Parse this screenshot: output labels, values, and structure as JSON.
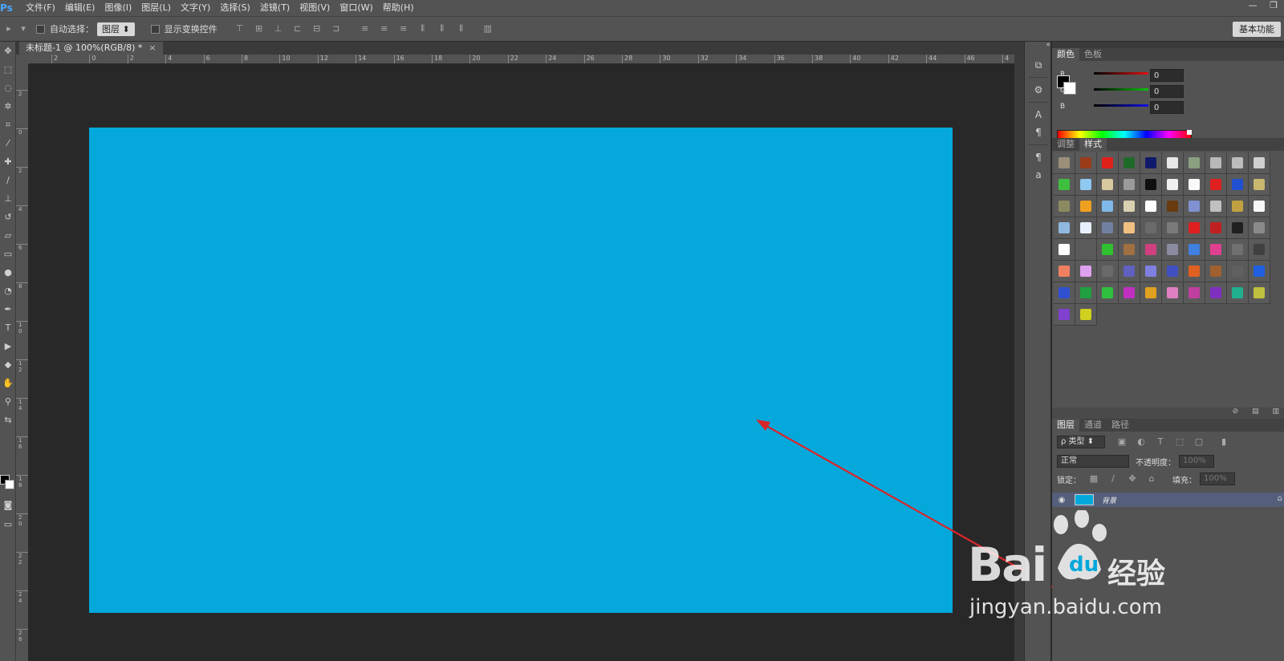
{
  "app": {
    "logo": "Ps",
    "menu": [
      "文件(F)",
      "编辑(E)",
      "图像(I)",
      "图层(L)",
      "文字(Y)",
      "选择(S)",
      "滤镜(T)",
      "视图(V)",
      "窗口(W)",
      "帮助(H)"
    ],
    "window_buttons": [
      "—",
      "❐"
    ]
  },
  "options_bar": {
    "auto_select_label": "自动选择：",
    "auto_select_value": "图层",
    "show_transform_label": "显示变换控件",
    "workspace": "基本功能"
  },
  "document": {
    "tab_title": "未标题-1 @ 100%(RGB/8) *",
    "close_glyph": "×",
    "canvas_color": "#04a8db"
  },
  "rulers": {
    "h_labels": [
      "2",
      "0",
      "2",
      "4",
      "6",
      "8",
      "10",
      "12",
      "14",
      "16",
      "18",
      "20",
      "22",
      "24",
      "26",
      "28",
      "30",
      "32",
      "34",
      "36",
      "38",
      "40",
      "42",
      "44",
      "46",
      "4"
    ],
    "v_labels": [
      "2",
      "0",
      "2",
      "4",
      "6",
      "8",
      "1\n0",
      "1\n2",
      "1\n4",
      "1\n6",
      "1\n8",
      "2\n0",
      "2\n2",
      "2\n4",
      "2\n6"
    ]
  },
  "color_panel": {
    "tabs": [
      "颜色",
      "色板"
    ],
    "channels": [
      {
        "label": "R",
        "value": "0",
        "color": "#e01010"
      },
      {
        "label": "G",
        "value": "0",
        "color": "#10c010"
      },
      {
        "label": "B",
        "value": "0",
        "color": "#1010e0"
      }
    ]
  },
  "styles_panel": {
    "tabs": [
      "调整",
      "样式"
    ],
    "swatches": [
      "#9a8f78",
      "#9a3b1a",
      "#e0201a",
      "#1f6a2a",
      "#101a6a",
      "#e8e8e8",
      "#8aa080",
      "#b8b8b8",
      "#bcbcbc",
      "#d0d0d0",
      "#3fbf3f",
      "#8fc8f0",
      "#d8c8a0",
      "#9a9a9a",
      "#101010",
      "#f0f0f0",
      "#fafafa",
      "#e02020",
      "#2050d0",
      "#c8b870",
      "#8a8a60",
      "#f0a020",
      "#80b8e8",
      "#d8d0b0",
      "#ffffff",
      "#6a3a10",
      "#8090d0",
      "#c0c0c0",
      "#c0a040",
      "#f8f8f8",
      "#90b8e0",
      "#e8f0ff",
      "#7080a0",
      "#f0c080",
      "#6a6a6a",
      "#7a7a7a",
      "#e02020",
      "#c02020",
      "#202020",
      "#8a8a8a",
      "#ffffff",
      "#5a5a5a",
      "#30c030",
      "#a07040",
      "#d04080",
      "#8a8aa0",
      "#4080e0",
      "#e04090",
      "#707070",
      "#404040",
      "#f08060",
      "#e0a0f0",
      "#6a6a6a",
      "#6060c0",
      "#8080e0",
      "#4050c0",
      "#e06020",
      "#a06030",
      "#606060",
      "#2060e0",
      "#3050d0",
      "#20a040",
      "#30c040",
      "#c030c0",
      "#e0a020",
      "#e080c0",
      "#c040a0",
      "#8030c0",
      "#20b090",
      "#c0c040",
      "#8040d0",
      "#d0d020"
    ]
  },
  "layers_panel": {
    "tabs": [
      "图层",
      "通道",
      "路径"
    ],
    "filter_label": "ρ 类型",
    "blend_mode": "正常",
    "opacity_label": "不透明度：",
    "opacity_value": "100%",
    "lock_label": "锁定：",
    "fill_label": "填充：",
    "fill_value": "100%",
    "layers": [
      {
        "name": "背景",
        "color": "#04a8db"
      }
    ]
  },
  "watermark": {
    "logo": "Bai",
    "logo_suffix": "经验",
    "url": "jingyan.baidu.com"
  }
}
